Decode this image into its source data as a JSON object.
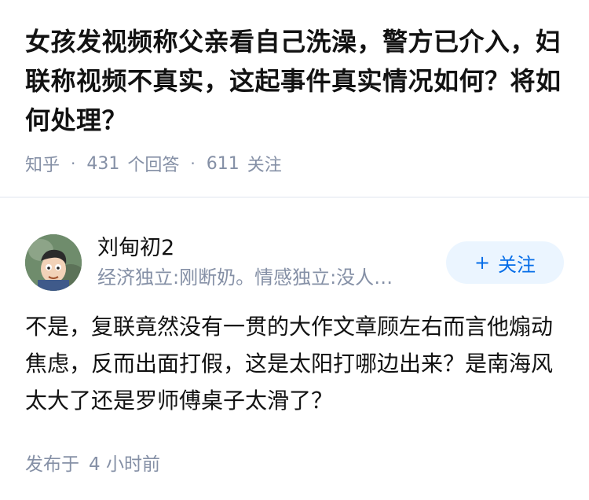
{
  "question": {
    "title": "女孩发视频称父亲看自己洗澡，警方已介入，妇联称视频不真实，这起事件真实情况如何？将如何处理？",
    "source": "知乎",
    "answers_count": "431",
    "answers_label": "个回答",
    "followers_count": "611",
    "followers_label": "关注"
  },
  "answer": {
    "author_name": "刘甸初2",
    "author_bio": "经济独立:刚断奶。情感独立:没人…",
    "follow_label": "关注",
    "follow_plus": "+",
    "content": "不是，复联竟然没有一贯的大作文章顾左右而言他煽动焦虑，反而出面打假，这是太阳打哪边出来？是南海风太大了还是罗师傅桌子太滑了？",
    "time_prefix": "发布于",
    "time_value": "4 小时前"
  },
  "colors": {
    "title": "#121212",
    "meta": "#8590a6",
    "follow_bg": "#ebf5ff",
    "follow_text": "#056de8"
  },
  "icons": {
    "avatar": "cartoon-avatar"
  }
}
